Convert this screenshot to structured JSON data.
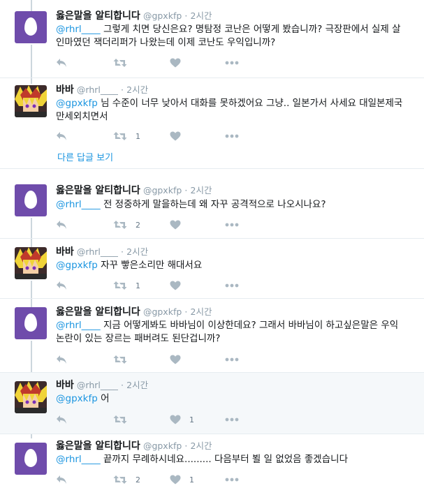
{
  "colors": {
    "link": "#1b95e0",
    "egg_avatar": "#6f4cab",
    "muted": "#8899a6",
    "highlight_bg": "#f5f8fa"
  },
  "icons": [
    "reply-icon",
    "retweet-icon",
    "like-icon",
    "more-icon",
    "egg-avatar",
    "anime-avatar"
  ],
  "more_replies_label": "다른 답글 보기",
  "tweets": [
    {
      "name": "옳은말을 알티합니다",
      "handle": "@gpxkfp",
      "dot": "·",
      "time": "2시간",
      "mention": "@rhrl____",
      "text": " 그렇게 치면 당신은요? 명탐정 코난은 어떻게 봤습니까? 극장판에서 실제 살인마였던 잭더리퍼가 나왔는데 이제 코난도 우익입니까?",
      "retweets": "",
      "likes": ""
    },
    {
      "name": "바바",
      "handle": "@rhrl____",
      "dot": "·",
      "time": "2시간",
      "mention": "@gpxkfp",
      "text": " 님 수준이 너무 낮아서 대화를 못하겠어요 그냥.. 일본가서 사세요 대일본제국만세외치면서",
      "retweets": "1",
      "likes": ""
    },
    {
      "name": "옳은말을 알티합니다",
      "handle": "@gpxkfp",
      "dot": "·",
      "time": "2시간",
      "mention": "@rhrl____",
      "text": " 전 정중하게 말을하는데 왜 자꾸 공격적으로 나오시나요?",
      "retweets": "2",
      "likes": ""
    },
    {
      "name": "바바",
      "handle": "@rhrl____",
      "dot": "·",
      "time": "2시간",
      "mention": "@gpxkfp",
      "text": " 자꾸 빻은소리만 해대서요",
      "retweets": "1",
      "likes": ""
    },
    {
      "name": "옳은말을 알티합니다",
      "handle": "@gpxkfp",
      "dot": "·",
      "time": "2시간",
      "mention": "@rhrl____",
      "text": " 지금 어떻게봐도 바바님이 이상한데요? 그래서 바바님이 하고싶은말은 우익논란이 있는 장르는 패버려도 된단겁니까?",
      "retweets": "",
      "likes": ""
    },
    {
      "name": "바바",
      "handle": "@rhrl____",
      "dot": "·",
      "time": "2시간",
      "mention": "@gpxkfp",
      "text": " 어",
      "retweets": "",
      "likes": "1"
    },
    {
      "name": "옳은말을 알티합니다",
      "handle": "@gpxkfp",
      "dot": "·",
      "time": "2시간",
      "mention": "@rhrl____",
      "text": " 끝까지 무례하시네요......... 다음부터 뵐 일 없었음 좋겠습니다",
      "retweets": "2",
      "likes": "1"
    }
  ]
}
